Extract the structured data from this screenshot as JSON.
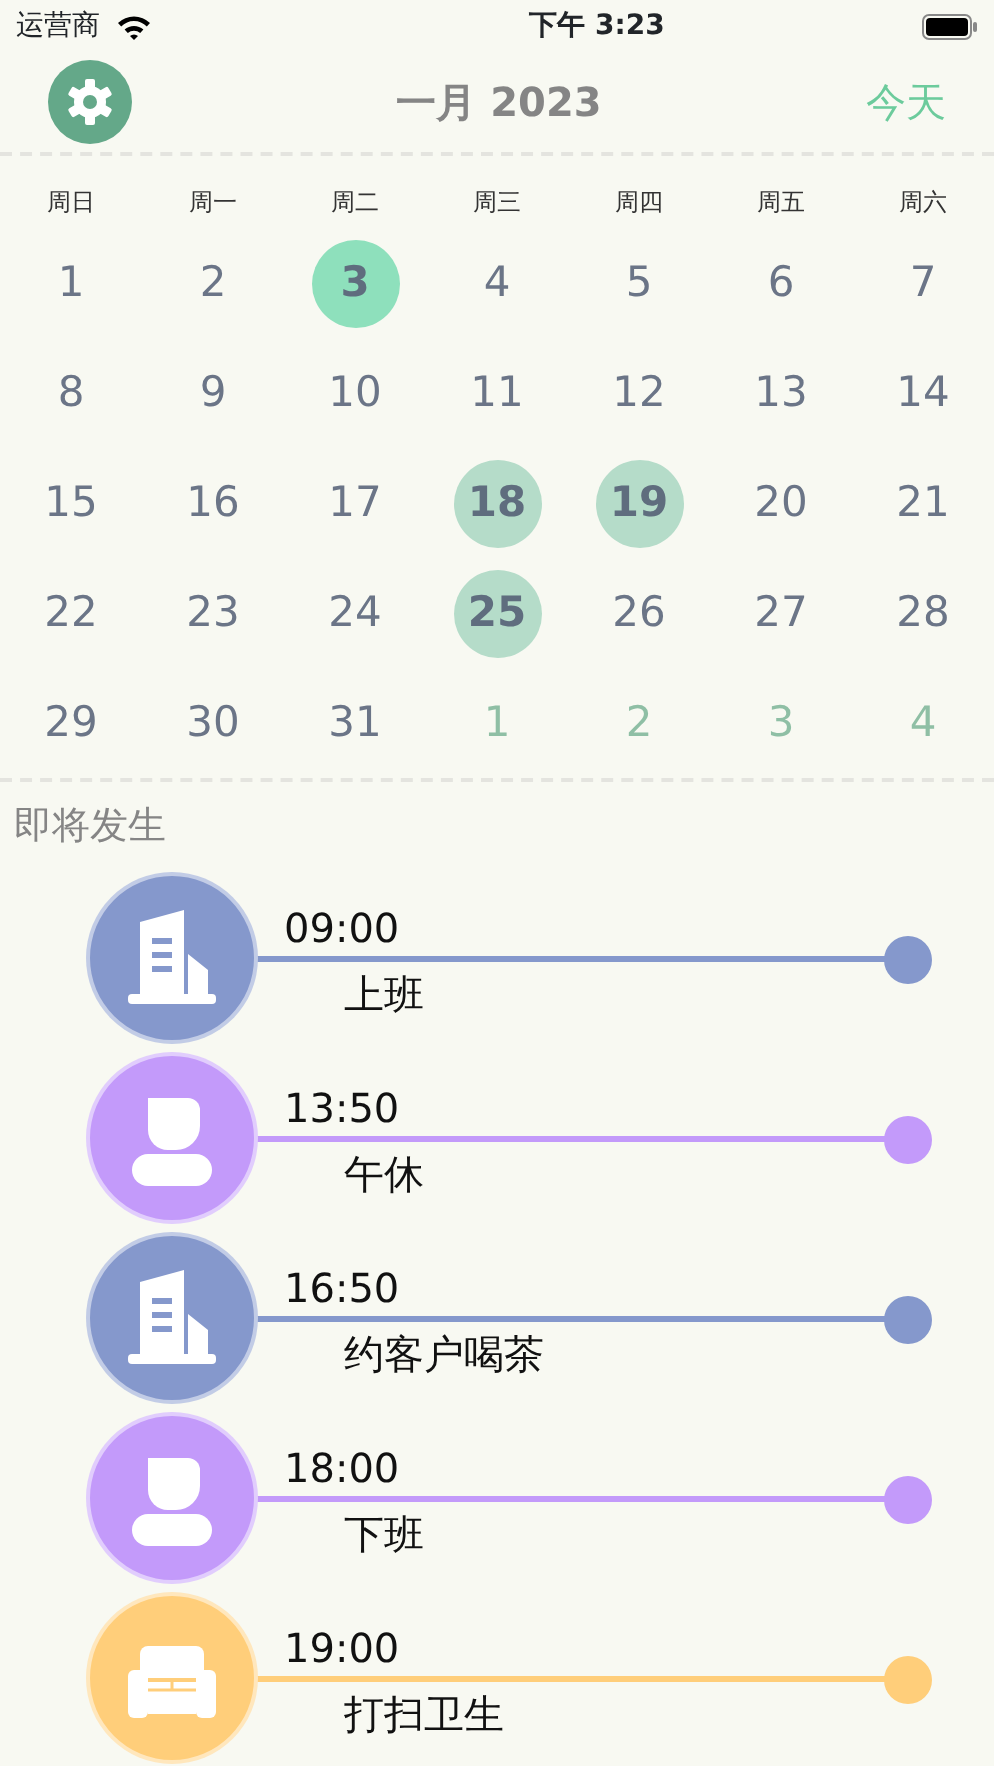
{
  "status_bar": {
    "carrier": "运营商",
    "time": "下午 3:23"
  },
  "header": {
    "title": "一月 2023",
    "today_button": "今天"
  },
  "weekdays": [
    "周日",
    "周一",
    "周二",
    "周三",
    "周四",
    "周五",
    "周六"
  ],
  "days": [
    {
      "label": "1",
      "selected": false,
      "has_event": false,
      "other_month": false
    },
    {
      "label": "2",
      "selected": false,
      "has_event": false,
      "other_month": false
    },
    {
      "label": "3",
      "selected": true,
      "has_event": false,
      "other_month": false
    },
    {
      "label": "4",
      "selected": false,
      "has_event": false,
      "other_month": false
    },
    {
      "label": "5",
      "selected": false,
      "has_event": false,
      "other_month": false
    },
    {
      "label": "6",
      "selected": false,
      "has_event": false,
      "other_month": false
    },
    {
      "label": "7",
      "selected": false,
      "has_event": false,
      "other_month": false
    },
    {
      "label": "8",
      "selected": false,
      "has_event": false,
      "other_month": false
    },
    {
      "label": "9",
      "selected": false,
      "has_event": false,
      "other_month": false
    },
    {
      "label": "10",
      "selected": false,
      "has_event": false,
      "other_month": false
    },
    {
      "label": "11",
      "selected": false,
      "has_event": false,
      "other_month": false
    },
    {
      "label": "12",
      "selected": false,
      "has_event": false,
      "other_month": false
    },
    {
      "label": "13",
      "selected": false,
      "has_event": false,
      "other_month": false
    },
    {
      "label": "14",
      "selected": false,
      "has_event": false,
      "other_month": false
    },
    {
      "label": "15",
      "selected": false,
      "has_event": false,
      "other_month": false
    },
    {
      "label": "16",
      "selected": false,
      "has_event": false,
      "other_month": false
    },
    {
      "label": "17",
      "selected": false,
      "has_event": false,
      "other_month": false
    },
    {
      "label": "18",
      "selected": false,
      "has_event": true,
      "other_month": false
    },
    {
      "label": "19",
      "selected": false,
      "has_event": true,
      "other_month": false
    },
    {
      "label": "20",
      "selected": false,
      "has_event": false,
      "other_month": false
    },
    {
      "label": "21",
      "selected": false,
      "has_event": false,
      "other_month": false
    },
    {
      "label": "22",
      "selected": false,
      "has_event": false,
      "other_month": false
    },
    {
      "label": "23",
      "selected": false,
      "has_event": false,
      "other_month": false
    },
    {
      "label": "24",
      "selected": false,
      "has_event": false,
      "other_month": false
    },
    {
      "label": "25",
      "selected": false,
      "has_event": true,
      "other_month": false
    },
    {
      "label": "26",
      "selected": false,
      "has_event": false,
      "other_month": false
    },
    {
      "label": "27",
      "selected": false,
      "has_event": false,
      "other_month": false
    },
    {
      "label": "28",
      "selected": false,
      "has_event": false,
      "other_month": false
    },
    {
      "label": "29",
      "selected": false,
      "has_event": false,
      "other_month": false
    },
    {
      "label": "30",
      "selected": false,
      "has_event": false,
      "other_month": false
    },
    {
      "label": "31",
      "selected": false,
      "has_event": false,
      "other_month": false
    },
    {
      "label": "1",
      "selected": false,
      "has_event": false,
      "other_month": true
    },
    {
      "label": "2",
      "selected": false,
      "has_event": false,
      "other_month": true
    },
    {
      "label": "3",
      "selected": false,
      "has_event": false,
      "other_month": true
    },
    {
      "label": "4",
      "selected": false,
      "has_event": false,
      "other_month": true
    }
  ],
  "upcoming": {
    "title": "即将发生",
    "events": [
      {
        "time": "09:00",
        "title": "上班",
        "kind": "building",
        "color": "#8598cc"
      },
      {
        "time": "13:50",
        "title": "午休",
        "kind": "person",
        "color": "#c39afa"
      },
      {
        "time": "16:50",
        "title": "约客户喝茶",
        "kind": "building",
        "color": "#8598cc"
      },
      {
        "time": "18:00",
        "title": "下班",
        "kind": "person",
        "color": "#c39afa"
      },
      {
        "time": "19:00",
        "title": "打扫卫生",
        "kind": "sofa",
        "color": "#ffce7a"
      }
    ]
  }
}
